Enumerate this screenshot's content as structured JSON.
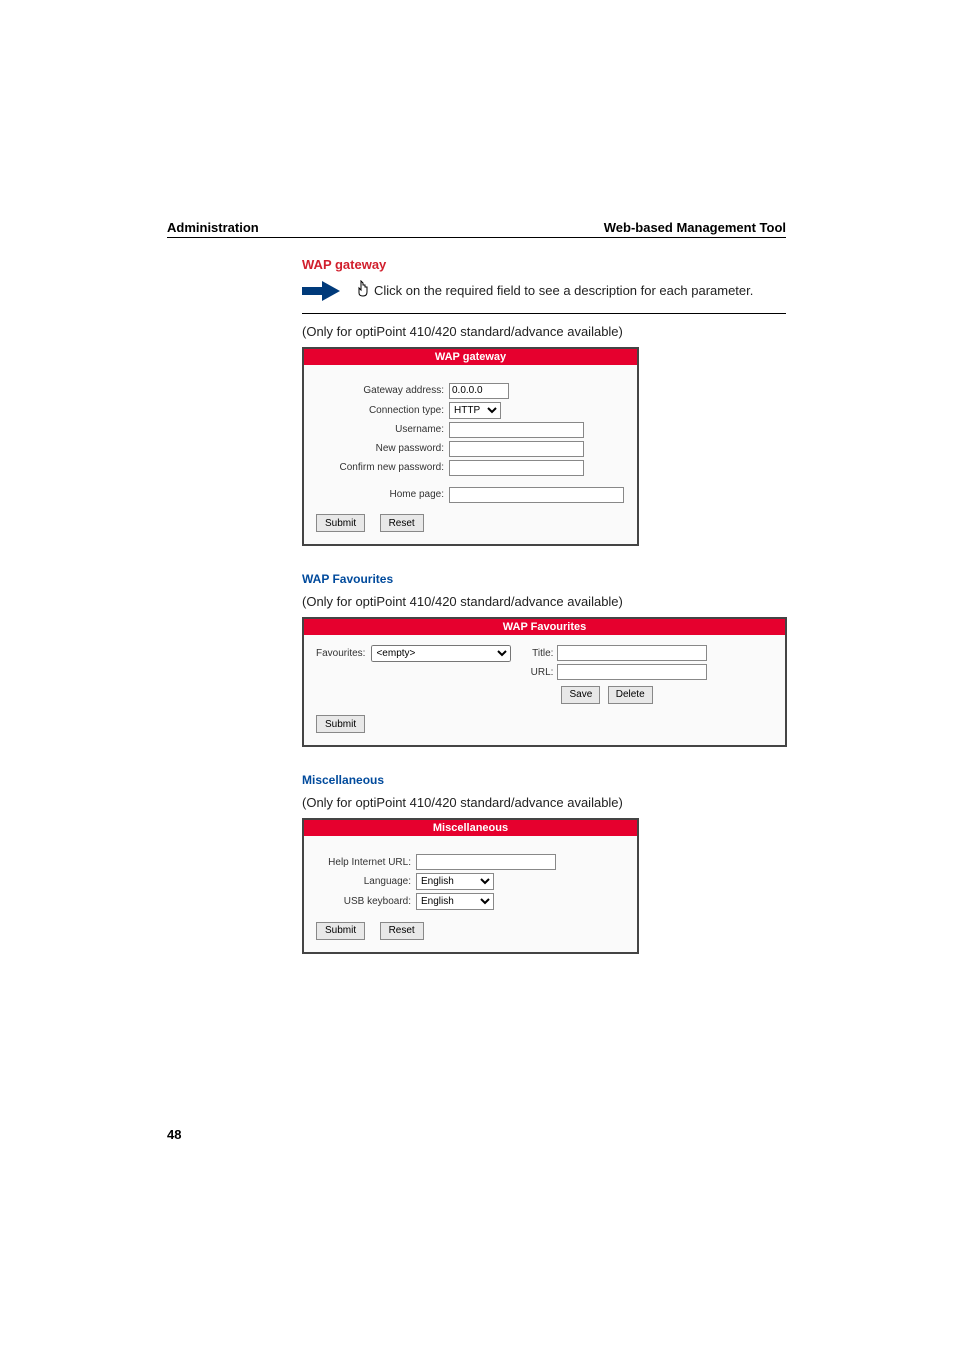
{
  "header": {
    "left": "Administration",
    "right": "Web-based Management Tool"
  },
  "note": {
    "text": "Click on the required field to see a description for each parameter."
  },
  "sections": {
    "wap_gateway": {
      "title": "WAP gateway",
      "availability": "(Only for optiPoint 410/420 standard/advance available)",
      "panel_title": "WAP gateway",
      "fields": {
        "gateway_address_label": "Gateway address:",
        "gateway_address_value": "0.0.0.0",
        "connection_type_label": "Connection type:",
        "connection_type_value": "HTTP",
        "username_label": "Username:",
        "username_value": "",
        "new_password_label": "New password:",
        "new_password_value": "",
        "confirm_password_label": "Confirm new password:",
        "confirm_password_value": "",
        "home_page_label": "Home page:",
        "home_page_value": ""
      },
      "buttons": {
        "submit": "Submit",
        "reset": "Reset"
      }
    },
    "wap_favourites": {
      "title": "WAP Favourites",
      "availability": "(Only for optiPoint 410/420 standard/advance available)",
      "panel_title": "WAP Favourites",
      "fields": {
        "favourites_label": "Favourites:",
        "favourites_value": "<empty>",
        "title_label": "Title:",
        "title_value": "",
        "url_label": "URL:",
        "url_value": ""
      },
      "buttons": {
        "save": "Save",
        "delete": "Delete",
        "submit": "Submit"
      }
    },
    "miscellaneous": {
      "title": "Miscellaneous",
      "availability": "(Only for optiPoint 410/420 standard/advance available)",
      "panel_title": "Miscellaneous",
      "fields": {
        "help_url_label": "Help Internet URL:",
        "help_url_value": "",
        "language_label": "Language:",
        "language_value": "English",
        "usb_keyboard_label": "USB keyboard:",
        "usb_keyboard_value": "English"
      },
      "buttons": {
        "submit": "Submit",
        "reset": "Reset"
      }
    }
  },
  "page_number": "48"
}
